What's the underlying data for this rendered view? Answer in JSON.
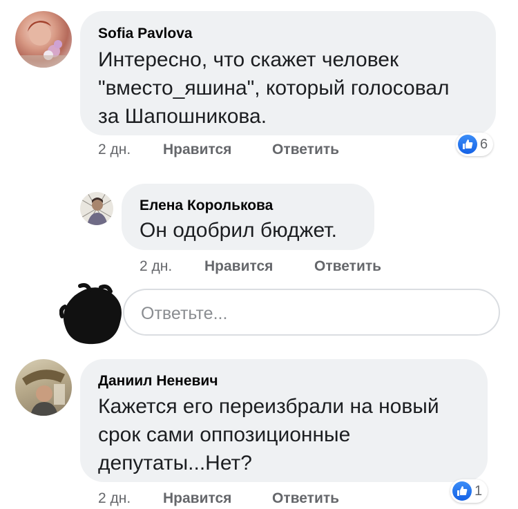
{
  "comments": [
    {
      "author": "Sofia Pavlova",
      "text": "Интересно, что скажет человек\n\"вместо_яшина\", который голосовал\nза Шапошникова.",
      "time": "2 дн.",
      "like_label": "Нравится",
      "reply_label": "Ответить",
      "reaction_count": "6"
    },
    {
      "author": "Елена Королькова",
      "text": "Он одобрил бюджет.",
      "time": "2 дн.",
      "like_label": "Нравится",
      "reply_label": "Ответить"
    },
    {
      "author": "Даниил Неневич",
      "text": "Кажется его переизбрали на новый\nсрок сами оппозиционные\nдепутаты...Нет?",
      "time": "2 дн.",
      "like_label": "Нравится",
      "reply_label": "Ответить",
      "reaction_count": "1"
    }
  ],
  "reply_input": {
    "placeholder": "Ответьте..."
  },
  "colors": {
    "bubble": "#eff1f3",
    "like_blue": "#1877f2",
    "meta_gray": "#65676b"
  },
  "icons": {
    "reaction": "thumbs-up-icon"
  }
}
